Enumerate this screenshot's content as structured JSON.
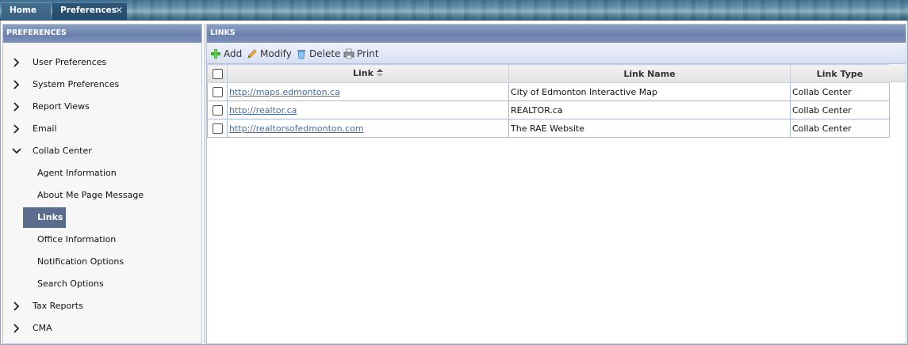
{
  "tabs": {
    "home": "Home",
    "preferences": "Preferences",
    "close": "✕"
  },
  "sidebar": {
    "title": "PREFERENCES",
    "items": [
      {
        "label": "User Preferences",
        "expanded": false
      },
      {
        "label": "System Preferences",
        "expanded": false
      },
      {
        "label": "Report Views",
        "expanded": false
      },
      {
        "label": "Email",
        "expanded": false
      },
      {
        "label": "Collab Center",
        "expanded": true
      },
      {
        "label": "Tax Reports",
        "expanded": false
      },
      {
        "label": "CMA",
        "expanded": false
      }
    ],
    "subitems": [
      {
        "label": "Agent Information"
      },
      {
        "label": "About Me Page Message"
      },
      {
        "label": "Links",
        "active": true
      },
      {
        "label": "Office Information"
      },
      {
        "label": "Notification Options"
      },
      {
        "label": "Search Options"
      }
    ]
  },
  "main": {
    "title": "LINKS",
    "toolbar": {
      "add": "Add",
      "modify": "Modify",
      "delete": "Delete",
      "print": "Print"
    },
    "columns": [
      "Link",
      "Link Name",
      "Link Type"
    ],
    "rows": [
      {
        "link": "http://maps.edmonton.ca",
        "name": "City of Edmonton Interactive Map",
        "type": "Collab Center"
      },
      {
        "link": "http://realtor.ca",
        "name": "REALTOR.ca",
        "type": "Collab Center"
      },
      {
        "link": "http://realtorsofedmonton.com",
        "name": "The RAE Website",
        "type": "Collab Center"
      }
    ]
  },
  "colors": {
    "panel_header": "#7086b1",
    "active_nav": "#5a6d8c",
    "link_text": "#4a6d9b"
  }
}
